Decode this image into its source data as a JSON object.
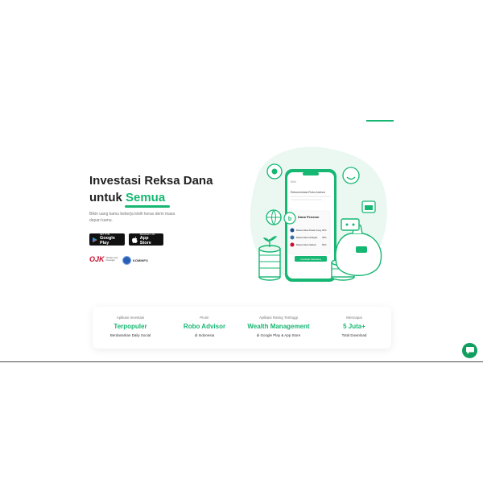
{
  "hero": {
    "title_line1": "Investasi Reksa Dana",
    "title_line2_prefix": "untuk ",
    "title_line2_accent": "Semua",
    "description": "Bikin uang kamu bekerja lebih keras demi masa depan kamu."
  },
  "stores": {
    "google_play": {
      "small": "GET IT ON",
      "big": "Google Play"
    },
    "app_store": {
      "small": "Download on the",
      "big": "App Store"
    }
  },
  "badges": {
    "ojk_mark": "OJK",
    "ojk_sub": "Otoritas Jasa Keuangan",
    "kominfo": "KOMINFO"
  },
  "phone": {
    "header": "Bibit",
    "section": "Rekomendasi Robo Advisor",
    "card_title": "Dana Pensiun",
    "funds": [
      {
        "name": "Reksa Dana Pasar Uang",
        "pct": "20%"
      },
      {
        "name": "Reksa Dana Obligasi",
        "pct": "30%"
      },
      {
        "name": "Reksa Dana Saham",
        "pct": "50%"
      }
    ],
    "cta": "Investasi Sekarang"
  },
  "stats": [
    {
      "caption": "Aplikasi Investasi",
      "value": "Terpopuler",
      "footer": "Berdasarkan Daily Social"
    },
    {
      "caption": "Pionir",
      "value": "Robo Advisor",
      "footer": "di Indonesia"
    },
    {
      "caption": "Aplikasi Rating Tertinggi",
      "value": "Wealth Management",
      "footer": "di Google Play & App Store"
    },
    {
      "caption": "Mencapai",
      "value": "5 Juta+",
      "footer": "Total Download"
    }
  ],
  "colors": {
    "accent": "#16b772",
    "dark_green": "#129e5f",
    "light_green": "#e8f7ef"
  },
  "icons": {
    "chat": "chat-bubble-icon",
    "google_play": "play-triangle-icon",
    "app_store": "apple-icon"
  }
}
